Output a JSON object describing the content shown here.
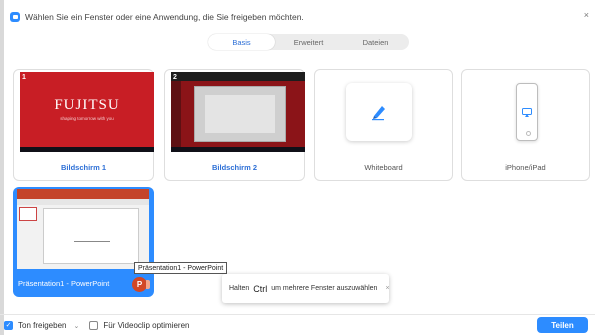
{
  "header": {
    "title": "Wählen Sie ein Fenster oder eine Anwendung, die Sie freigeben möchten.",
    "close_glyph": "×"
  },
  "tabs": [
    {
      "label": "Basis",
      "active": true
    },
    {
      "label": "Erweitert",
      "active": false
    },
    {
      "label": "Dateien",
      "active": false
    }
  ],
  "sources": [
    {
      "label": "Bildschirm 1",
      "number": "1",
      "logo_text": "FUJITSU",
      "slogan_text": "shaping tomorrow with you"
    },
    {
      "label": "Bildschirm 2",
      "number": "2"
    },
    {
      "label": "Whiteboard",
      "icon": "pen-icon"
    },
    {
      "label": "iPhone/iPad",
      "icon": "airplay-icon"
    },
    {
      "label": "Präsentation1 - PowerPoint",
      "selected": true,
      "app_letter": "P"
    }
  ],
  "tooltip": {
    "text": "Präsentation1 - PowerPoint"
  },
  "hint": {
    "prefix": "Halten",
    "key": "Ctrl",
    "suffix": "um mehrere Fenster auszuwählen",
    "close_glyph": "×"
  },
  "footer": {
    "sound_label": "Ton freigeben",
    "sound_checked": true,
    "video_label": "Für Videoclip optimieren",
    "video_checked": false,
    "share_label": "Teilen"
  },
  "colors": {
    "accent": "#2d8cff",
    "fujitsu_red": "#c81e25",
    "powerpoint": "#d24726"
  }
}
